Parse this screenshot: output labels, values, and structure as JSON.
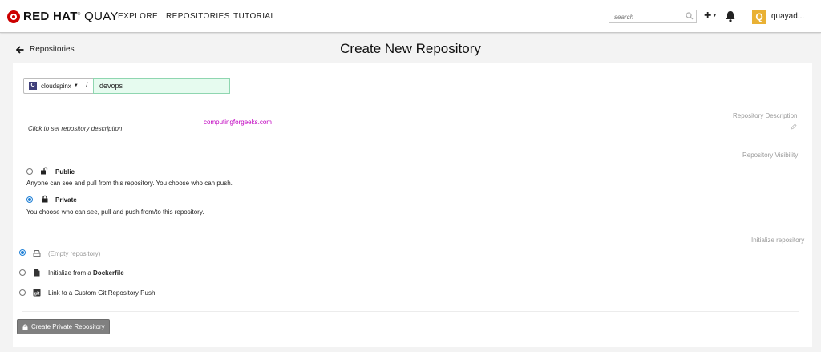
{
  "header": {
    "logo_brand": "RED HAT",
    "logo_product": "QUAY",
    "nav": {
      "explore": "EXPLORE",
      "repositories": "REPOSITORIES",
      "tutorial": "TUTORIAL"
    },
    "search_placeholder": "search",
    "avatar_letter": "Q",
    "username": "quayad..."
  },
  "subheader": {
    "back_label": "Repositories",
    "title": "Create New Repository"
  },
  "form": {
    "namespace": {
      "badge": "C",
      "label": "cloudspinx"
    },
    "separator": "/",
    "repo_name": "devops",
    "description": {
      "section_label": "Repository Description",
      "placeholder": "Click to set repository description",
      "watermark": "computingforgeeks.com"
    },
    "visibility": {
      "section_label": "Repository Visibility",
      "options": [
        {
          "title": "Public",
          "desc": "Anyone can see and pull from this repository. You choose who can push.",
          "selected": false,
          "icon": "unlock-icon"
        },
        {
          "title": "Private",
          "desc": "You choose who can see, pull and push from/to this repository.",
          "selected": true,
          "icon": "lock-icon"
        }
      ]
    },
    "initialize": {
      "section_label": "Initialize repository",
      "options": [
        {
          "label": "(Empty repository)",
          "selected": true,
          "icon": "drive-icon"
        },
        {
          "label_prefix": "Initialize from a ",
          "label_bold": "Dockerfile",
          "selected": false,
          "icon": "file-icon"
        },
        {
          "label": "Link to a Custom Git Repository Push",
          "selected": false,
          "icon": "git-icon"
        }
      ]
    },
    "submit_label": "Create Private Repository"
  },
  "colors": {
    "brand_red": "#cc0000",
    "avatar": "#e9b134",
    "radio_selected": "#1e7fd6",
    "repo_input_bg": "#e6fbef",
    "submit_bg": "#808080",
    "watermark": "#c000c0"
  }
}
